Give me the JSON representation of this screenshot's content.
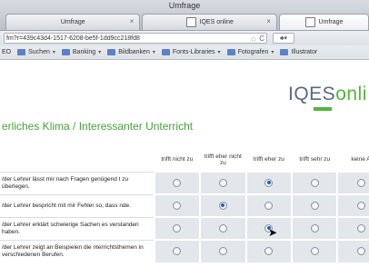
{
  "window": {
    "title": "Umfrage",
    "tabs": [
      {
        "label": "Umfrage",
        "active": false
      },
      {
        "label": "IQES online",
        "active": false
      },
      {
        "label": "Umfrage",
        "active": true
      }
    ],
    "url": "fm?r=439c43d4-1517-6208-be5f-1dd9cc218fd8"
  },
  "bookmarks": [
    {
      "label": "EO",
      "folder": false
    },
    {
      "label": "Suchen",
      "folder": true
    },
    {
      "label": "Banking",
      "folder": true
    },
    {
      "label": "Bildbanken",
      "folder": true
    },
    {
      "label": "Fonts-Libraries",
      "folder": true
    },
    {
      "label": "Fotografen",
      "folder": true
    },
    {
      "label": "Illustrator",
      "folder": true
    }
  ],
  "logo": {
    "iqes": "IQES",
    "online": "onli"
  },
  "heading": "erliches Klima / Interessanter Unterricht",
  "columns": [
    "trifft nicht zu",
    "trifft eher nicht zu",
    "trifft eher zu",
    "trifft sehr zu",
    "keine A"
  ],
  "questions": [
    {
      "text": "/der Lehrer lässt mir nach Fragen genügend t zu überlegen.",
      "selected": 2
    },
    {
      "text": "/der Lehrer bespricht mit mir Fehler so, dass nde.",
      "selected": 1
    },
    {
      "text": "/der Lehrer erklärt schwierige Sachen es verstanden haben.",
      "selected": 2
    },
    {
      "text": "/der Lehrer zeigt an Beispielen die nterrichtsthemen in verschiedenen Berufen.",
      "selected": -1
    }
  ],
  "colors": {
    "accent": "#53b43d",
    "logo_grey": "#5a6a7e",
    "radio_selected": "#1f62c9"
  }
}
